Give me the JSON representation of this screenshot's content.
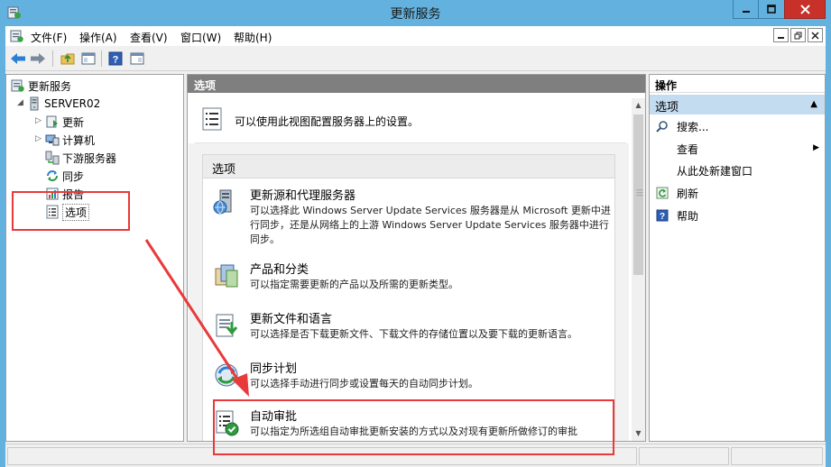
{
  "window": {
    "title": "更新服务"
  },
  "menu": {
    "items": [
      "文件(F)",
      "操作(A)",
      "查看(V)",
      "窗口(W)",
      "帮助(H)"
    ]
  },
  "toolbar": {
    "icons": [
      "back-arrow-icon",
      "forward-arrow-icon",
      "up-folder-icon",
      "show-hide-tree-icon",
      "help-icon",
      "action-pane-icon"
    ]
  },
  "tree": {
    "root": "更新服务",
    "server": "SERVER02",
    "children": [
      "更新",
      "计算机",
      "下游服务器",
      "同步",
      "报告",
      "选项"
    ],
    "selected": "选项"
  },
  "center": {
    "header": "选项",
    "intro": "可以使用此视图配置服务器上的设置。",
    "section_title": "选项",
    "options": [
      {
        "title": "更新源和代理服务器",
        "desc": "可以选择此 Windows Server Update Services 服务器是从 Microsoft 更新中进行同步，还是从网络上的上游 Windows Server Update Services 服务器中进行同步。"
      },
      {
        "title": "产品和分类",
        "desc": "可以指定需要更新的产品以及所需的更新类型。"
      },
      {
        "title": "更新文件和语言",
        "desc": "可以选择是否下载更新文件、下载文件的存储位置以及要下载的更新语言。"
      },
      {
        "title": "同步计划",
        "desc": "可以选择手动进行同步或设置每天的自动同步计划。"
      },
      {
        "title": "自动审批",
        "desc": "可以指定为所选组自动审批更新安装的方式以及对现有更新所做修订的审批"
      }
    ]
  },
  "actions": {
    "header": "操作",
    "section": "选项",
    "items": [
      "搜索...",
      "查看",
      "从此处新建窗口",
      "刷新",
      "帮助"
    ]
  },
  "colors": {
    "title_bar": "#62b1de",
    "close_button": "#c7312a",
    "annotation": "#e83a3a",
    "pane_header": "#7f7f7f",
    "action_section": "#c3dcf0"
  }
}
